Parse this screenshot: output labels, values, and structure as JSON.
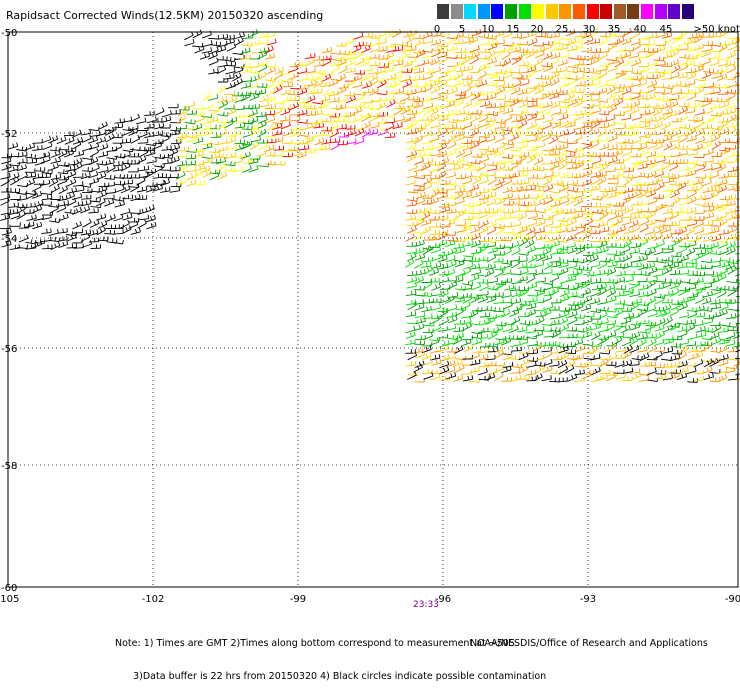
{
  "title": "Rapidsact Corrected Winds(12.5KM) 20150320 ascending",
  "colorbar": {
    "colors": [
      "#3c3c3c",
      "#8c8c8c",
      "#00d8ff",
      "#0096ff",
      "#0000ff",
      "#00a000",
      "#00e000",
      "#ffff00",
      "#ffc800",
      "#ff9600",
      "#ff5a00",
      "#ff0000",
      "#c80000",
      "#a05a28",
      "#783c14",
      "#ff00ff",
      "#b400ff",
      "#6400c8",
      "#280078"
    ],
    "labels": [
      "0",
      "5",
      "10",
      "15",
      "20",
      "25",
      "30",
      "35",
      "40",
      "45",
      ">50 knots"
    ]
  },
  "lat_labels": [
    "-50",
    "-52",
    "-54",
    "-56",
    "-58",
    "-60"
  ],
  "lon_labels": [
    "-105",
    "-102",
    "-99",
    "-96",
    "-93",
    "-90"
  ],
  "time_label": "23:33",
  "notes": [
    "Note: 1) Times are GMT 2)Times along bottom correspond to measurement at ~50S",
    "      3)Data buffer is 22 hrs from 20150320 4) Black circles indicate possible contamination"
  ],
  "credit": "NOAA/NESDIS/Office of Research and Applications"
}
